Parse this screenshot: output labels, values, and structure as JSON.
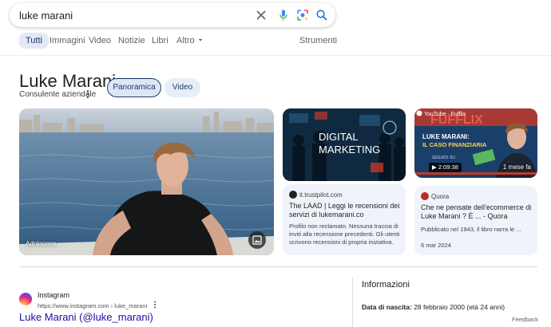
{
  "search": {
    "query": "luke marani",
    "clear_icon": "close-icon",
    "voice_icon": "mic-icon",
    "lens_icon": "lens-icon",
    "search_icon": "search-icon"
  },
  "tabs": {
    "items": [
      {
        "label": "Tutti",
        "active": true
      },
      {
        "label": "Immagini"
      },
      {
        "label": "Video"
      },
      {
        "label": "Notizie"
      },
      {
        "label": "Libri"
      },
      {
        "label": "Altro"
      }
    ],
    "tools_label": "Strumenti"
  },
  "entity": {
    "title": "Luke Marani",
    "subtitle": "Consulente aziendale",
    "chips": [
      "Panoramica",
      "Video"
    ]
  },
  "main_image": {
    "credit": "Adnkronos"
  },
  "cards": {
    "trustpilot": {
      "image_text_1": "DIGITAL",
      "image_text_2": "MARKETING",
      "source": "it.trustpilot.com",
      "title": "The LAAD | Leggi le recensioni dei servizi di lukemarani.co",
      "snippet": "Profilo non reclamato. Nessuna traccia di inviti alla recensione precedenti. Gli utenti scrivono recensioni di propria iniziativa."
    },
    "youtube": {
      "channel": "YouTube · Fufflix",
      "banner": "FUFFLIX",
      "headline_1": "LUKE MARANI:",
      "headline_2": "IL CASO FINANZIARIA",
      "follow_label": "SEGUICI SU",
      "duration": "2:09:38",
      "age": "1 mese fa"
    },
    "quora": {
      "source": "Quora",
      "title": "Che ne pensate dell'ecommerce di Luke Marani ? È ... - Quora",
      "snippet": "Pubblicato nel 1943, il libro narra le ...",
      "date": "6 mar 2024"
    }
  },
  "result": {
    "site_name": "Instagram",
    "url": "https://www.instagram.com › luke_marani",
    "title": "Luke Marani (@luke_marani)"
  },
  "info": {
    "heading": "Informazioni",
    "birth_label": "Data di nascita:",
    "birth_value": "28 febbraio 2000 (età 24 anni)"
  },
  "feedback_label": "Feedback",
  "colors": {
    "link": "#1a0dab",
    "accent": "#1a73e8",
    "chip_active_bg": "#dde6f6",
    "card_bg": "#f0f4fa"
  }
}
